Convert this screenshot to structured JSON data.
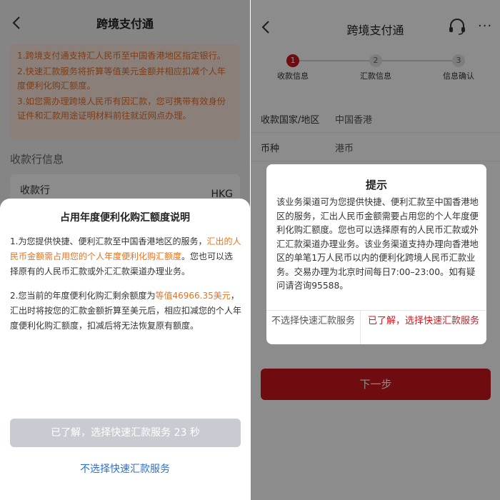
{
  "left": {
    "nav": {
      "title": "跨境支付通"
    },
    "notice": [
      "1.跨境支付通支持汇人民币至中国香港地区指定银行。",
      "2.快速汇款服务将折算等值美元金额并相应扣减个人年度便利化购汇额度。",
      "3.如您需办理跨境人民币有因汇款，您可携带有效身份证件和汇款用途证明材料前往就近网点办理。"
    ],
    "section_title": "收款行信息",
    "bank": {
      "label": "收款行",
      "value": "HKG"
    },
    "sheet": {
      "title": "占用年度便利化购汇额度说明",
      "p1_a": "1.为您提供快捷、便利汇款至中国香港地区的服务，",
      "p1_hl": "汇出的人民币金额需占用您的个人年度便利化购汇额度",
      "p1_b": "。您也可以选择原有的人民币汇款或外汇汇款渠道办理业务。",
      "p2_a": "2.您当前的年度便利化购汇剩余额度为",
      "p2_hl": "等值46966.35美元",
      "p2_b": "，汇出时将按您的汇款金额折算至美元后，相应扣减您的个人年度便利化购汇额度，扣减后将无法恢复原有额度。",
      "timer_button": "已了解，选择快速汇款服务 23 秒",
      "link_button": "不选择快速汇款服务"
    }
  },
  "right": {
    "nav": {
      "title": "跨境支付通",
      "more": "···"
    },
    "steps": [
      {
        "num": "1",
        "label": "收款信息"
      },
      {
        "num": "2",
        "label": "汇款信息"
      },
      {
        "num": "3",
        "label": "信息确认"
      }
    ],
    "form": [
      {
        "label": "收款国家/地区",
        "value": "中国香港"
      },
      {
        "label": "币种",
        "value": "港币"
      }
    ],
    "next_button": "下一步",
    "dialog": {
      "title": "提示",
      "body": "该业务渠道可为您提供快捷、便利汇款至中国香港地区的服务，汇出人民币金额需要占用您的个人年度便利化购汇额度。您也可以选择原有的人民币汇款或外汇汇款渠道办理业务。该业务渠道支持办理向香港地区的单笔1万人民币以内的便利化跨境人民币汇款业务。交易办理为北京时间每日7:00–23:00。如有疑问请咨询95588。",
      "cancel": "不选择快速汇款服务",
      "ok": "已了解，选择快速汇款服务"
    }
  },
  "colors": {
    "accent_red": "#c8161d",
    "highlight_orange": "#e37424",
    "link_blue": "#2d6fc7",
    "notice_bg": "#fbeadc"
  }
}
